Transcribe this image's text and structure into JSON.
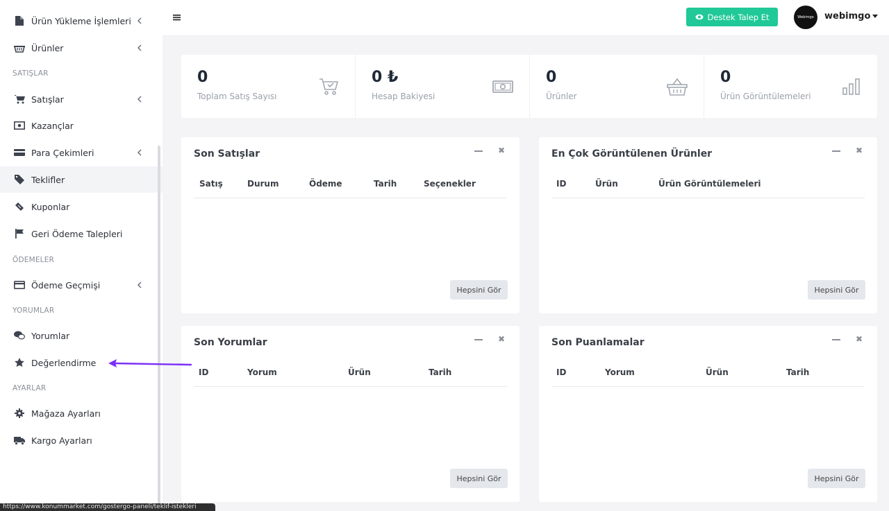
{
  "sidebar": {
    "items": [
      {
        "label": "Ürün Yükleme İşlemleri",
        "icon": "file-icon",
        "chevron": true
      },
      {
        "label": "Ürünler",
        "icon": "basket-icon",
        "chevron": true
      },
      {
        "label": "Satışlar",
        "icon": "cart-icon",
        "chevron": true
      },
      {
        "label": "Kazançlar",
        "icon": "money-icon",
        "chevron": false
      },
      {
        "label": "Para Çekimleri",
        "icon": "card-icon",
        "chevron": true
      },
      {
        "label": "Teklifler",
        "icon": "tag-icon",
        "chevron": false
      },
      {
        "label": "Kuponlar",
        "icon": "ticket-icon",
        "chevron": false
      },
      {
        "label": "Geri Ödeme Talepleri",
        "icon": "flag-icon",
        "chevron": false
      },
      {
        "label": "Ödeme Geçmişi",
        "icon": "credit-card-icon",
        "chevron": true
      },
      {
        "label": "Yorumlar",
        "icon": "comments-icon",
        "chevron": false
      },
      {
        "label": "Değerlendirme",
        "icon": "star-icon",
        "chevron": false
      },
      {
        "label": "Mağaza Ayarları",
        "icon": "gear-icon",
        "chevron": false
      },
      {
        "label": "Kargo Ayarları",
        "icon": "truck-icon",
        "chevron": false
      }
    ],
    "sections": {
      "sales": "SATIŞLAR",
      "payments": "ÖDEMELER",
      "reviews": "YORUMLAR",
      "settings": "AYARLAR"
    }
  },
  "topbar": {
    "support_label": "Destek Talep Et",
    "username": "webimgo",
    "avatar_text": "Webimgo"
  },
  "stats": [
    {
      "value": "0",
      "label": "Toplam Satış Sayısı"
    },
    {
      "value": "0 ₺",
      "label": "Hesap Bakiyesi"
    },
    {
      "value": "0",
      "label": "Ürünler"
    },
    {
      "value": "0",
      "label": "Ürün Görüntülemeleri"
    }
  ],
  "cards": {
    "recent_sales": {
      "title": "Son Satışlar",
      "columns": [
        "Satış",
        "Durum",
        "Ödeme",
        "Tarih",
        "Seçenekler"
      ],
      "see_all": "Hepsini Gör"
    },
    "most_viewed": {
      "title": "En Çok Görüntülenen Ürünler",
      "columns": [
        "ID",
        "Ürün",
        "Ürün Görüntülemeleri"
      ],
      "see_all": "Hepsini Gör"
    },
    "recent_reviews": {
      "title": "Son Yorumlar",
      "columns": [
        "ID",
        "Yorum",
        "Ürün",
        "Tarih"
      ],
      "see_all": "Hepsini Gör"
    },
    "recent_ratings": {
      "title": "Son Puanlamalar",
      "columns": [
        "ID",
        "Yorum",
        "Ürün",
        "Tarih"
      ],
      "see_all": "Hepsini Gör"
    }
  },
  "status_url": "https://www.konummarket.com/gostergo-paneli/teklif-istekleri",
  "colors": {
    "accent": "#20c997",
    "annotation_arrow": "#7b2ff7"
  }
}
